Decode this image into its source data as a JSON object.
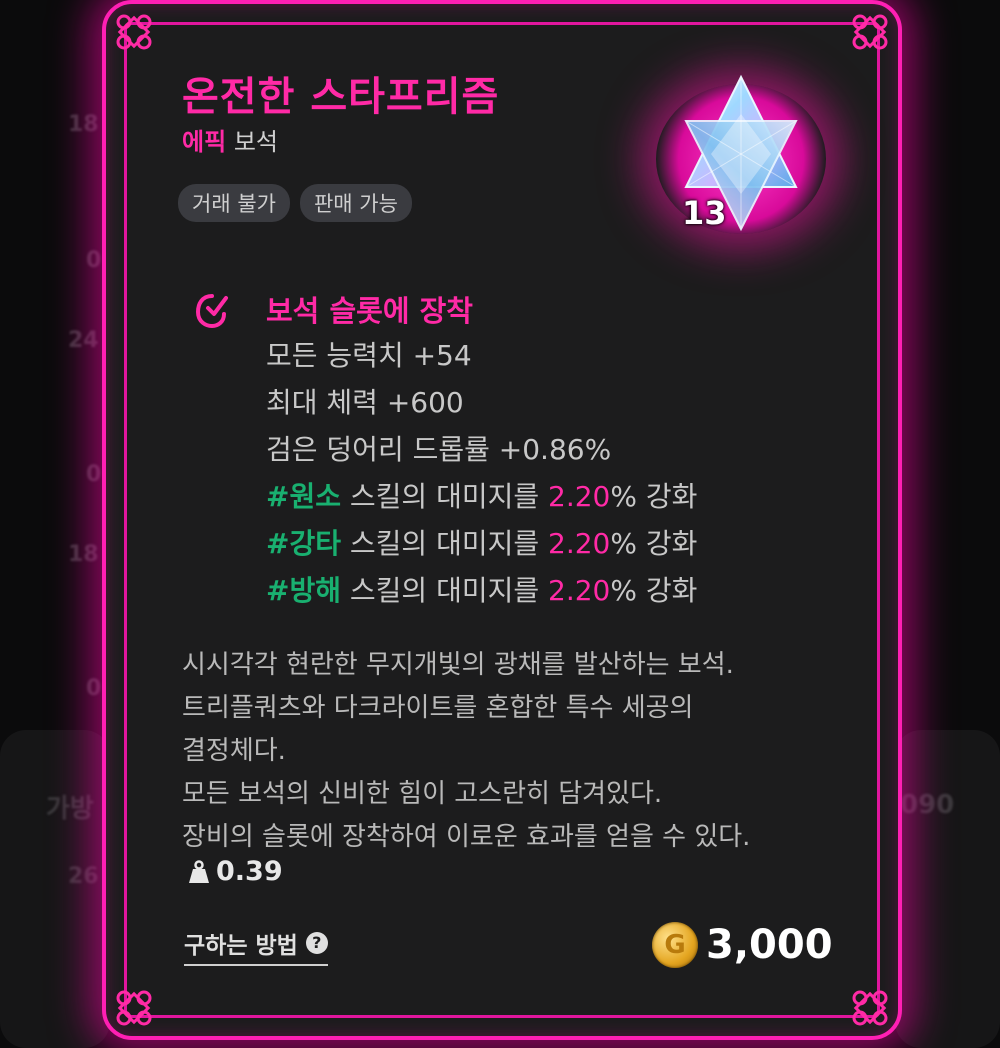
{
  "item": {
    "name": "온전한 스타프리즘",
    "grade": "에픽",
    "category": "보석",
    "tags": [
      "거래 불가",
      "판매 가능"
    ],
    "count": "13",
    "icon": "star-prism-gem-icon"
  },
  "effect": {
    "title": "보석 슬롯에 장착",
    "icon": "gem-slot-equip-icon",
    "stats": [
      "모든 능력치 +54",
      "최대 체력 +600",
      "검은 덩어리 드롭률 +0.86%"
    ],
    "skill_bonuses": [
      {
        "tag": "#원소",
        "text_before": " 스킬의 대미지를 ",
        "value": "2.20",
        "text_after": "% 강화"
      },
      {
        "tag": "#강타",
        "text_before": " 스킬의 대미지를 ",
        "value": "2.20",
        "text_after": "% 강화"
      },
      {
        "tag": "#방해",
        "text_before": " 스킬의 대미지를 ",
        "value": "2.20",
        "text_after": "% 강화"
      }
    ]
  },
  "description": [
    "시시각각 현란한 무지개빛의 광채를 발산하는 보석.",
    "트리플쿼츠와 다크라이트를 혼합한 특수 세공의",
    "결정체다.",
    "모든 보석의 신비한 힘이 고스란히 담겨있다.",
    "장비의 슬롯에 장착하여 이로운 효과를 얻을 수 있다."
  ],
  "weight": "0.39",
  "how_to_get": {
    "label": "구하는 방법",
    "help": "?"
  },
  "price": {
    "amount": "3,000",
    "currency_icon": "gold-coin-icon"
  },
  "background": {
    "fragments": [
      "18",
      "24",
      "18",
      "가방",
      "26",
      "090",
      "0",
      "0",
      "0"
    ]
  },
  "colors": {
    "accent": "#ff2aa6",
    "tag_green": "#19b070",
    "card_bg": "#1c1c1d"
  }
}
